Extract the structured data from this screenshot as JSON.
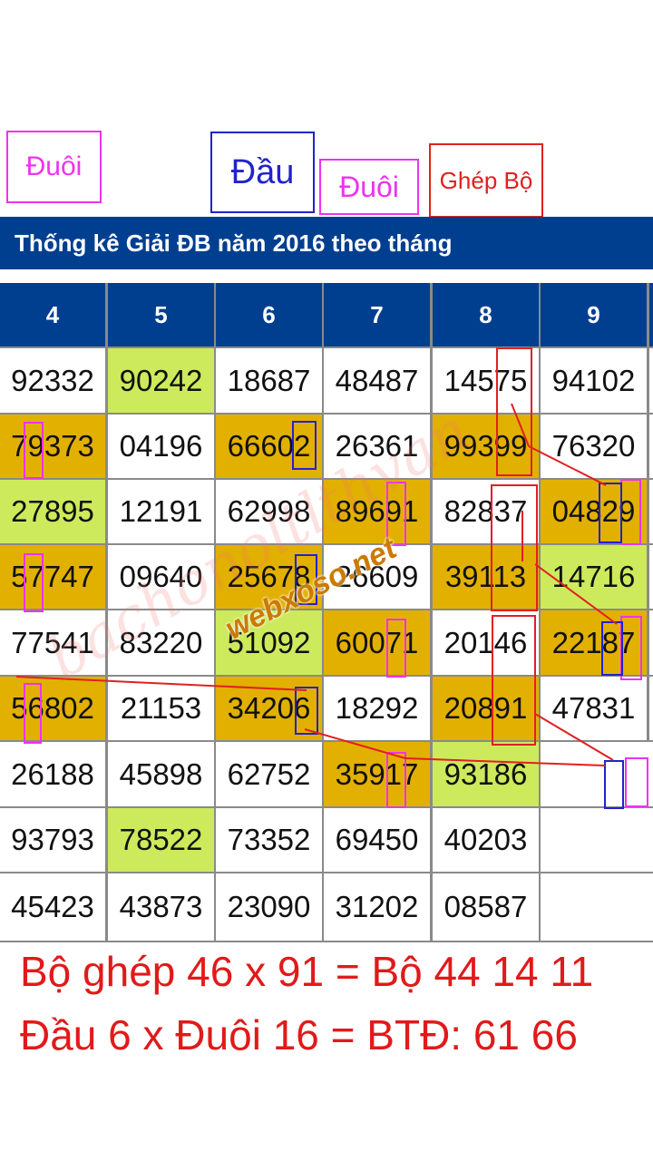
{
  "legend": {
    "duoi_1": "Đuôi",
    "dau": "Đầu",
    "duoi_2": "Đuôi",
    "ghep_bo": "Ghép Bộ"
  },
  "title": "Thống kê Giải ĐB năm 2016 theo tháng",
  "columns": [
    "4",
    "5",
    "6",
    "7",
    "8",
    "9"
  ],
  "rows": [
    [
      "92332",
      "90242",
      "18687",
      "48487",
      "14575",
      "94102"
    ],
    [
      "79373",
      "04196",
      "66602",
      "26361",
      "99399",
      "76320"
    ],
    [
      "27895",
      "12191",
      "62998",
      "89691",
      "82837",
      "04829"
    ],
    [
      "57747",
      "09640",
      "25678",
      "26609",
      "39113",
      "14716"
    ],
    [
      "77541",
      "83220",
      "51092",
      "60071",
      "20146",
      "22187"
    ],
    [
      "56802",
      "21153",
      "34206",
      "18292",
      "20891",
      "47831"
    ],
    [
      "26188",
      "45898",
      "62752",
      "35917",
      "93186",
      ""
    ],
    [
      "93793",
      "78522",
      "73352",
      "69450",
      "40203",
      ""
    ],
    [
      "45423",
      "43873",
      "23090",
      "31202",
      "08587",
      ""
    ]
  ],
  "colors": {
    "header_blue": "#003f8f",
    "highlight_green": "#cdea5c",
    "highlight_orange": "#e2b000",
    "mark_red": "#e02020",
    "mark_blue": "#2222cc",
    "mark_pink": "#ee33ee"
  },
  "watermark": "webxoso.net",
  "notes": {
    "line1": "Bộ ghép 46 x 91 = Bộ 44 14 11",
    "line2": "Đầu 6 x Đuôi 16 = BTĐ: 61 66"
  }
}
